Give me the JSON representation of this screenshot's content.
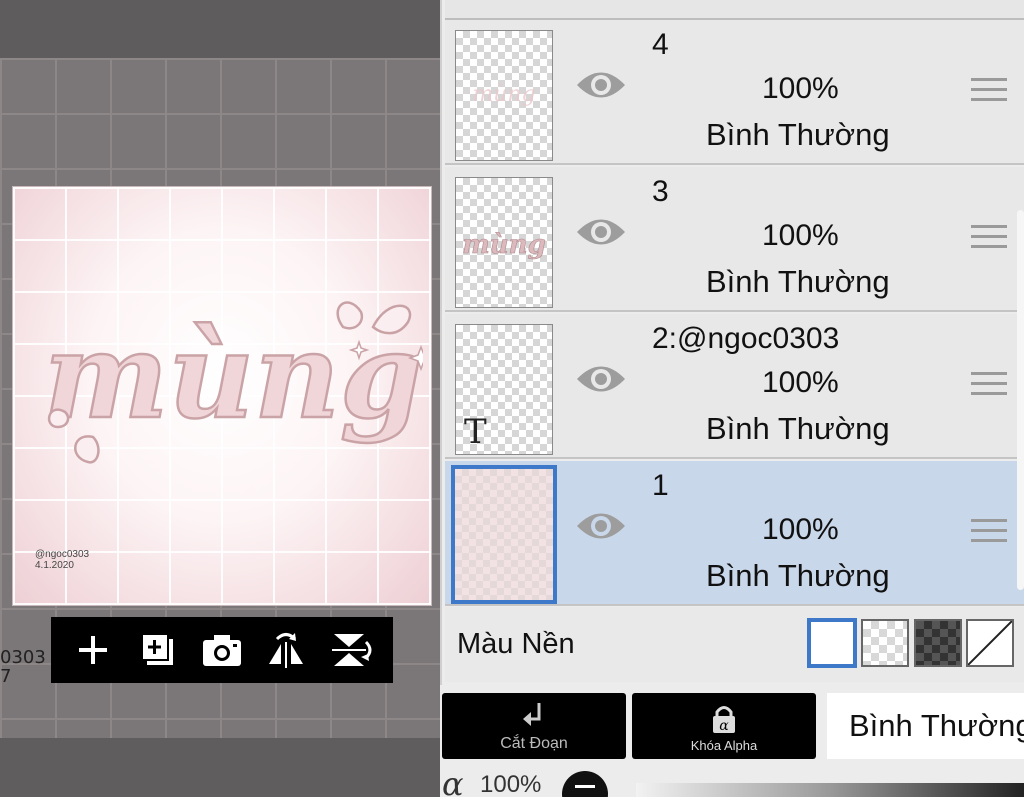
{
  "canvas": {
    "art_text": "mùng",
    "watermark": [
      "@ngoc0303",
      "4.1.2020"
    ],
    "background_partial_text": "0303\n7"
  },
  "toolbar": {
    "buttons": [
      {
        "icon": "plus-icon"
      },
      {
        "icon": "add-layer-icon"
      },
      {
        "icon": "camera-icon"
      },
      {
        "icon": "flip-horizontal-icon"
      },
      {
        "icon": "flip-vertical-icon"
      }
    ]
  },
  "layers": [
    {
      "name": "4",
      "opacity": "100%",
      "blend": "Bình Thường",
      "selected": false
    },
    {
      "name": "3",
      "opacity": "100%",
      "blend": "Bình Thường",
      "selected": false
    },
    {
      "name": "2:@ngoc0303",
      "opacity": "100%",
      "blend": "Bình Thường",
      "selected": false,
      "is_text_layer": true
    },
    {
      "name": "1",
      "opacity": "100%",
      "blend": "Bình Thường",
      "selected": true
    }
  ],
  "background_color": {
    "label": "Màu Nền",
    "options": [
      "white",
      "transparent",
      "dark-checker",
      "none"
    ],
    "selected": "white"
  },
  "actions": {
    "clip_label": "Cắt Đoạn",
    "alpha_lock_label": "Khóa Alpha",
    "blend_mode_value": "Bình Thường"
  },
  "alpha": {
    "symbol": "α",
    "value": "100%"
  },
  "colors": {
    "selected_layer_bg": "#c9d7ea",
    "selection_border": "#3d78c9",
    "art_pink": "#e6b3b7"
  }
}
